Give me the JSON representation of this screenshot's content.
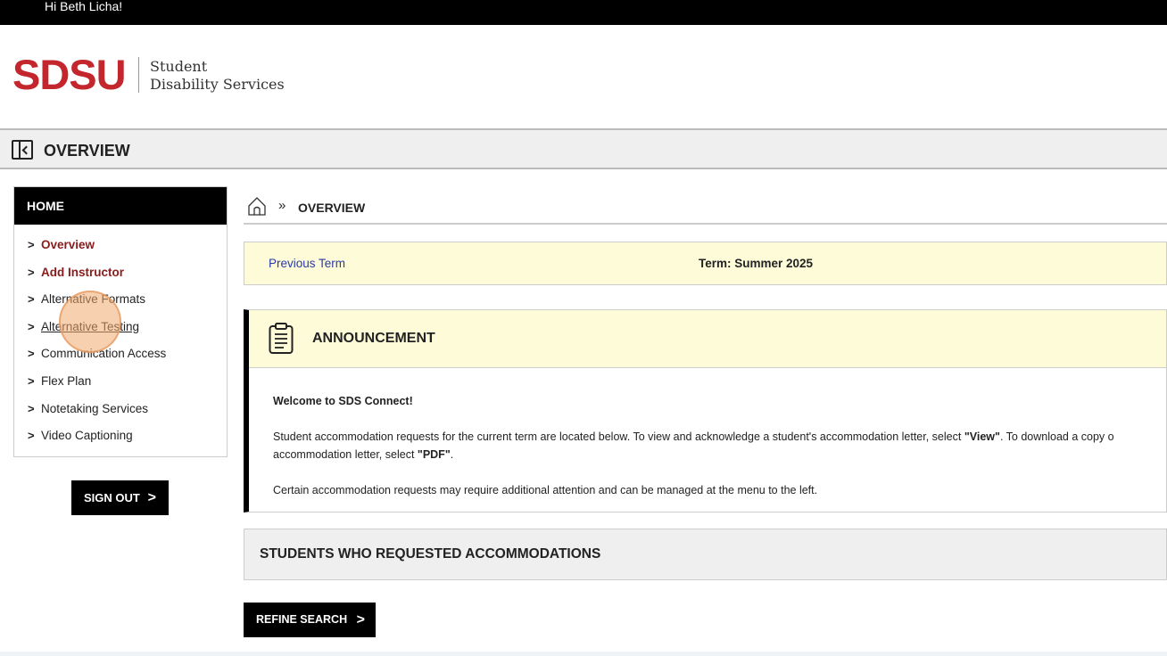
{
  "topbar": {
    "greeting": "Hi Beth Licha!"
  },
  "logo": {
    "brand": "SDSU",
    "line1": "Student",
    "line2": "Disability Services"
  },
  "header": {
    "title": "OVERVIEW"
  },
  "sidebar": {
    "heading": "HOME",
    "items": [
      {
        "label": "Overview"
      },
      {
        "label": "Add Instructor"
      },
      {
        "label": "Alternative Formats"
      },
      {
        "label": "Alternative Testing"
      },
      {
        "label": "Communication Access"
      },
      {
        "label": "Flex Plan"
      },
      {
        "label": "Notetaking Services"
      },
      {
        "label": "Video Captioning"
      }
    ],
    "signout_label": "SIGN OUT",
    "chevron": ">"
  },
  "breadcrumb": {
    "separator": "»",
    "current": "OVERVIEW"
  },
  "term": {
    "previous_label": "Previous Term",
    "current": "Term: Summer 2025"
  },
  "announcement": {
    "title": "ANNOUNCEMENT",
    "welcome": "Welcome to SDS Connect!",
    "p1_a": "Student accommodation requests for the current term are located below. To view and acknowledge a student's accommodation letter, select ",
    "p1_view": "\"View\"",
    "p1_b": ". To download a copy o",
    "p1_c": "accommodation letter, select ",
    "p1_pdf": "\"PDF\"",
    "p1_d": ".",
    "p2": "Certain accommodation requests may require additional attention and can be managed at the menu to the left."
  },
  "students": {
    "title": "STUDENTS WHO REQUESTED ACCOMMODATIONS"
  },
  "refine": {
    "label": "REFINE SEARCH",
    "arrow": ">"
  },
  "colors": {
    "brand_red": "#c4262e",
    "active_link": "#8b1b1b",
    "highlight_yellow": "#fefbd8",
    "link_blue": "#2a3aa6"
  }
}
